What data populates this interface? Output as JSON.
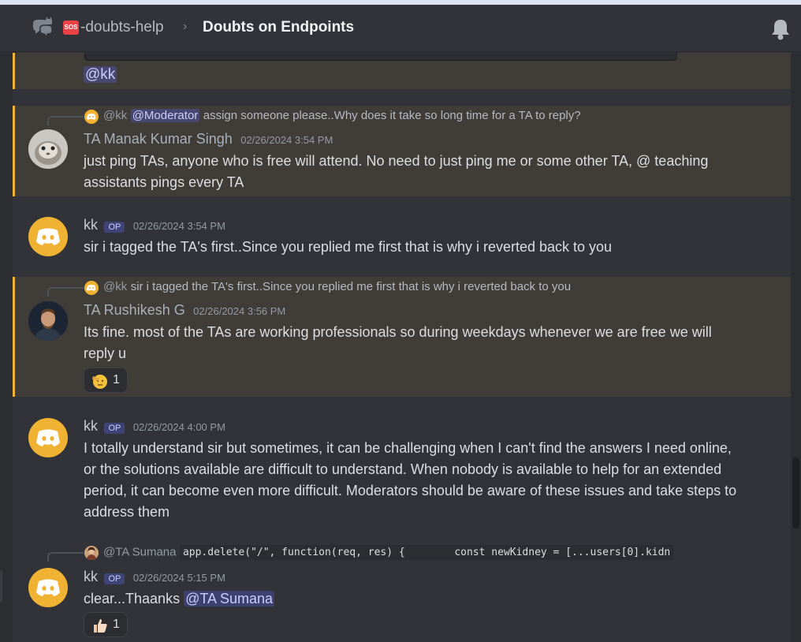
{
  "header": {
    "channel_name": "-doubts-help",
    "channel_badge": "SOS",
    "separator": "›",
    "thread_title": "Doubts on Endpoints"
  },
  "top_mention": "@kk",
  "messages": [
    {
      "reply": {
        "name": "@kk",
        "mention": "@Moderator",
        "text": "assign someone please..Why does it take so long time for a TA to reply?"
      },
      "author": "TA Manak Kumar Singh",
      "timestamp": "02/26/2024 3:54 PM",
      "text": "just ping TAs, anyone who is free will attend. No need to just ping me or some other TA, @ teaching assistants pings every TA"
    },
    {
      "author": "kk",
      "badge": "OP",
      "timestamp": "02/26/2024 3:54 PM",
      "text": "sir i tagged the TA's first..Since you replied me first that is why i reverted back to you"
    },
    {
      "reply": {
        "name": "@kk",
        "text": "sir i tagged the TA's first..Since you replied me first that is why i reverted back to you"
      },
      "author": "TA Rushikesh G",
      "timestamp": "02/26/2024 3:56 PM",
      "text": "Its fine. most of the TAs are working professionals so during weekdays whenever we are free we will reply u",
      "reaction_count": "1"
    },
    {
      "author": "kk",
      "badge": "OP",
      "timestamp": "02/26/2024 4:00 PM",
      "text": "I totally understand sir but sometimes, it can be challenging when I can't find the answers I need online, or the solutions available are difficult to understand. When nobody is available to help for an extended period, it can become even more difficult. Moderators should be aware of these issues and take steps to address them"
    },
    {
      "reply": {
        "name": "@TA Sumana",
        "code": "app.delete(\"/\", function(req, res) {        const newKidney = [...users[0].kidn"
      },
      "author": "kk",
      "badge": "OP",
      "timestamp": "02/26/2024 5:15 PM",
      "text": "clear...Thaanks",
      "mention": "@TA Sumana",
      "reaction_count": "1"
    }
  ],
  "colors": {
    "background": "#313338",
    "highlight": "#403d38",
    "highlight_border": "#f0b232",
    "discord_avatar": "#f0b232",
    "mention_bg": "#3c4270"
  }
}
